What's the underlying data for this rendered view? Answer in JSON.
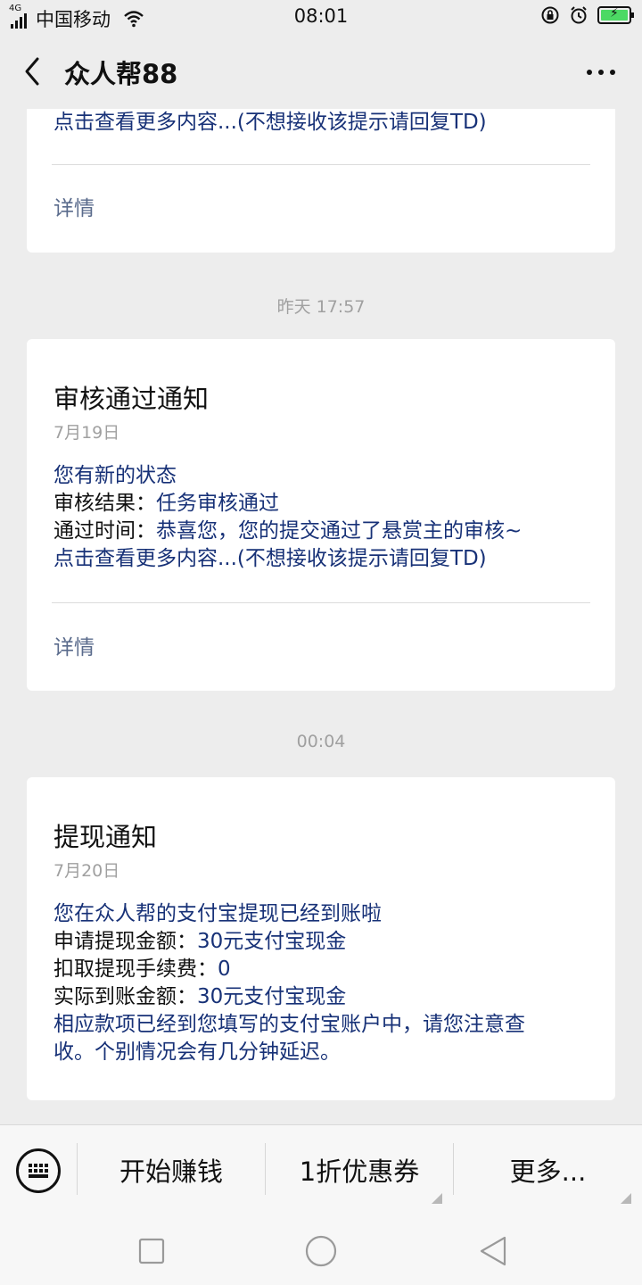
{
  "status_bar": {
    "network": "4G",
    "carrier": "中国移动",
    "time": "08:01",
    "battery_level": 1.0,
    "battery_color": "#4cd964"
  },
  "nav": {
    "back_icon": "chevron-left-icon",
    "title": "众人帮88",
    "more_icon": "more-dots-icon"
  },
  "messages": [
    {
      "body_lines": [
        {
          "text": "点击查看更多内容...(不想接收该提示请回复TD)",
          "style": "hl"
        }
      ],
      "link": "详情"
    },
    {
      "timestamp": "昨天 17:57",
      "title": "审核通过通知",
      "date": "7月19日",
      "body_lines": [
        {
          "text": "您有新的状态",
          "style": "hl"
        },
        {
          "label": "审核结果：",
          "value": "任务审核通过"
        },
        {
          "label": "通过时间：",
          "value": "恭喜您，您的提交通过了悬赏主的审核~"
        },
        {
          "text": "点击查看更多内容...(不想接收该提示请回复TD)",
          "style": "hl"
        }
      ],
      "link": "详情"
    },
    {
      "timestamp": "00:04",
      "title": "提现通知",
      "date": "7月20日",
      "body_lines": [
        {
          "text": "您在众人帮的支付宝提现已经到账啦",
          "style": "hl"
        },
        {
          "label": "申请提现金额：",
          "value": "30元支付宝现金"
        },
        {
          "label": "扣取提现手续费：",
          "value": "0"
        },
        {
          "label": "实际到账金额：",
          "value": "30元支付宝现金"
        },
        {
          "text": "相应款项已经到您填写的支付宝账户中，请您注意查",
          "style": "hl"
        },
        {
          "text": "收。个别情况会有几分钟延迟。",
          "style": "hl"
        }
      ]
    }
  ],
  "menu": {
    "keyboard_icon": "keyboard-icon",
    "items": [
      "开始赚钱",
      "1折优惠券",
      "更多..."
    ]
  },
  "system_nav": [
    "square-icon",
    "circle-icon",
    "triangle-back-icon"
  ],
  "colors": {
    "background": "#ededed",
    "card": "#ffffff",
    "highlight_text": "#173177",
    "link_text": "#5a6b8c",
    "muted_text": "#a0a0a0"
  }
}
